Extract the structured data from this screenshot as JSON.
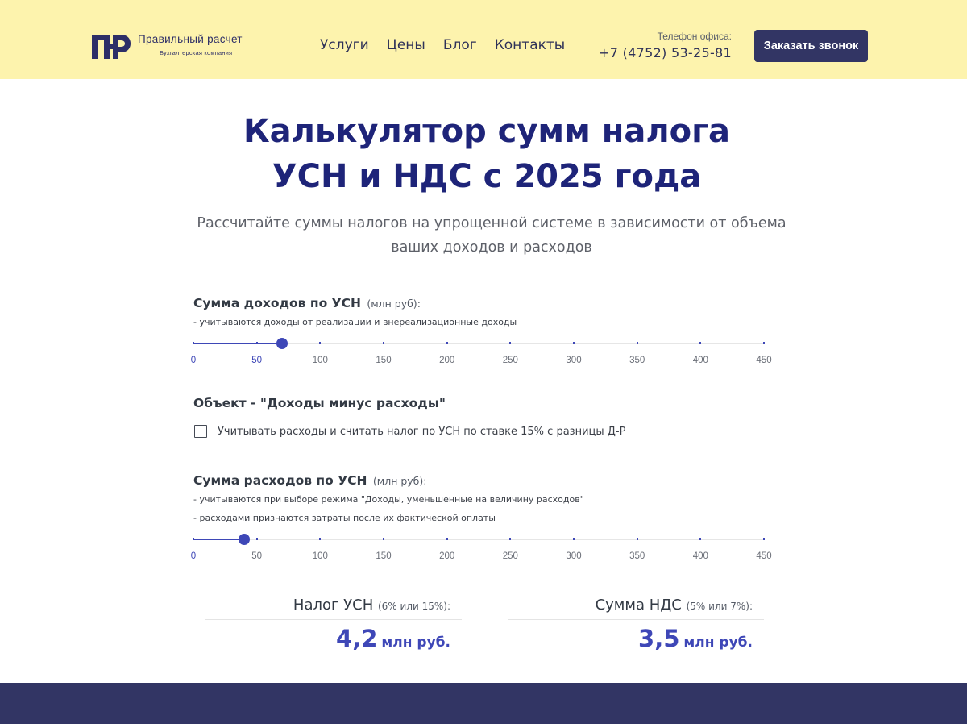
{
  "brand": {
    "name": "Правильный расчет",
    "tagline": "Бухгалтерская компания",
    "logo_color": "#2d2e67"
  },
  "nav": {
    "items": [
      "Услуги",
      "Цены",
      "Блог",
      "Контакты"
    ]
  },
  "contact": {
    "phone_label": "Телефон офиса:",
    "phone": "+7 (4752) 53-25-81",
    "callback_label": "Заказать звонок"
  },
  "hero": {
    "title_line1": "Калькулятор сумм налога",
    "title_line2": "УСН и НДС с 2025 года",
    "subtitle": "Рассчитайте суммы налогов на упрощенной системе в зависимости от объема ваших доходов и расходов"
  },
  "income": {
    "label": "Сумма доходов по УСН",
    "unit": "(млн руб):",
    "note": "- учитываются доходы от реализации и внереализационные доходы",
    "value": 70,
    "min": 0,
    "max": 450,
    "ticks": [
      "0",
      "50",
      "100",
      "150",
      "200",
      "250",
      "300",
      "350",
      "400",
      "450"
    ]
  },
  "object": {
    "label": "Объект - \"Доходы минус расходы\"",
    "checkbox_label": "Учитывать расходы и считать налог по УСН по ставке 15% с разницы Д-Р",
    "checked": false
  },
  "expenses": {
    "label": "Сумма расходов по УСН",
    "unit": "(млн руб):",
    "note1": "- учитываются при выборе режима \"Доходы, уменьшенные на величину расходов\"",
    "note2": "- расходами признаются затраты после их фактической оплаты",
    "value": 40,
    "min": 0,
    "max": 450,
    "ticks": [
      "0",
      "50",
      "100",
      "150",
      "200",
      "250",
      "300",
      "350",
      "400",
      "450"
    ]
  },
  "results": {
    "usn_title": "Налог УСН",
    "usn_rate": "(6% или 15%):",
    "usn_value": "4,2",
    "usn_unit": "млн руб.",
    "vat_title": "Сумма НДС",
    "vat_rate": "(5% или 7%):",
    "vat_value": "3,5",
    "vat_unit": "млн руб."
  },
  "colors": {
    "header_bg": "#fdf3ad",
    "title": "#1e2479",
    "accent": "#3e47b7",
    "button_bg": "#323564",
    "footer_bg": "#323564"
  }
}
